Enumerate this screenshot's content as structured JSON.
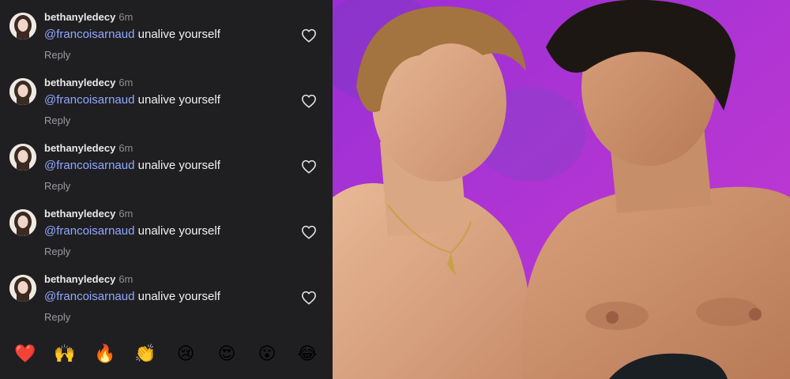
{
  "comments": [
    {
      "username": "bethanyledecy",
      "time": "6m",
      "mention": "@francoisarnaud",
      "text": " unalive yourself",
      "reply_label": "Reply"
    },
    {
      "username": "bethanyledecy",
      "time": "6m",
      "mention": "@francoisarnaud",
      "text": " unalive yourself",
      "reply_label": "Reply"
    },
    {
      "username": "bethanyledecy",
      "time": "6m",
      "mention": "@francoisarnaud",
      "text": " unalive yourself",
      "reply_label": "Reply"
    },
    {
      "username": "bethanyledecy",
      "time": "6m",
      "mention": "@francoisarnaud",
      "text": " unalive yourself",
      "reply_label": "Reply"
    },
    {
      "username": "bethanyledecy",
      "time": "6m",
      "mention": "@francoisarnaud",
      "text": " unalive yourself",
      "reply_label": "Reply"
    }
  ],
  "reactions": [
    {
      "emoji": "❤️",
      "name": "red-heart"
    },
    {
      "emoji": "🙌",
      "name": "raising-hands"
    },
    {
      "emoji": "🔥",
      "name": "fire"
    },
    {
      "emoji": "👏",
      "name": "clapping-hands"
    },
    {
      "emoji": "😢",
      "name": "crying-face"
    },
    {
      "emoji": "😍",
      "name": "heart-eyes"
    },
    {
      "emoji": "😮",
      "name": "surprised-face"
    },
    {
      "emoji": "😂",
      "name": "tears-of-joy"
    }
  ],
  "colors": {
    "background": "#1f1f22",
    "mention": "#92a8ff",
    "photo_background": "#b02fd0"
  },
  "icons": {
    "like": "heart-outline-icon",
    "avatar": "avatar"
  }
}
